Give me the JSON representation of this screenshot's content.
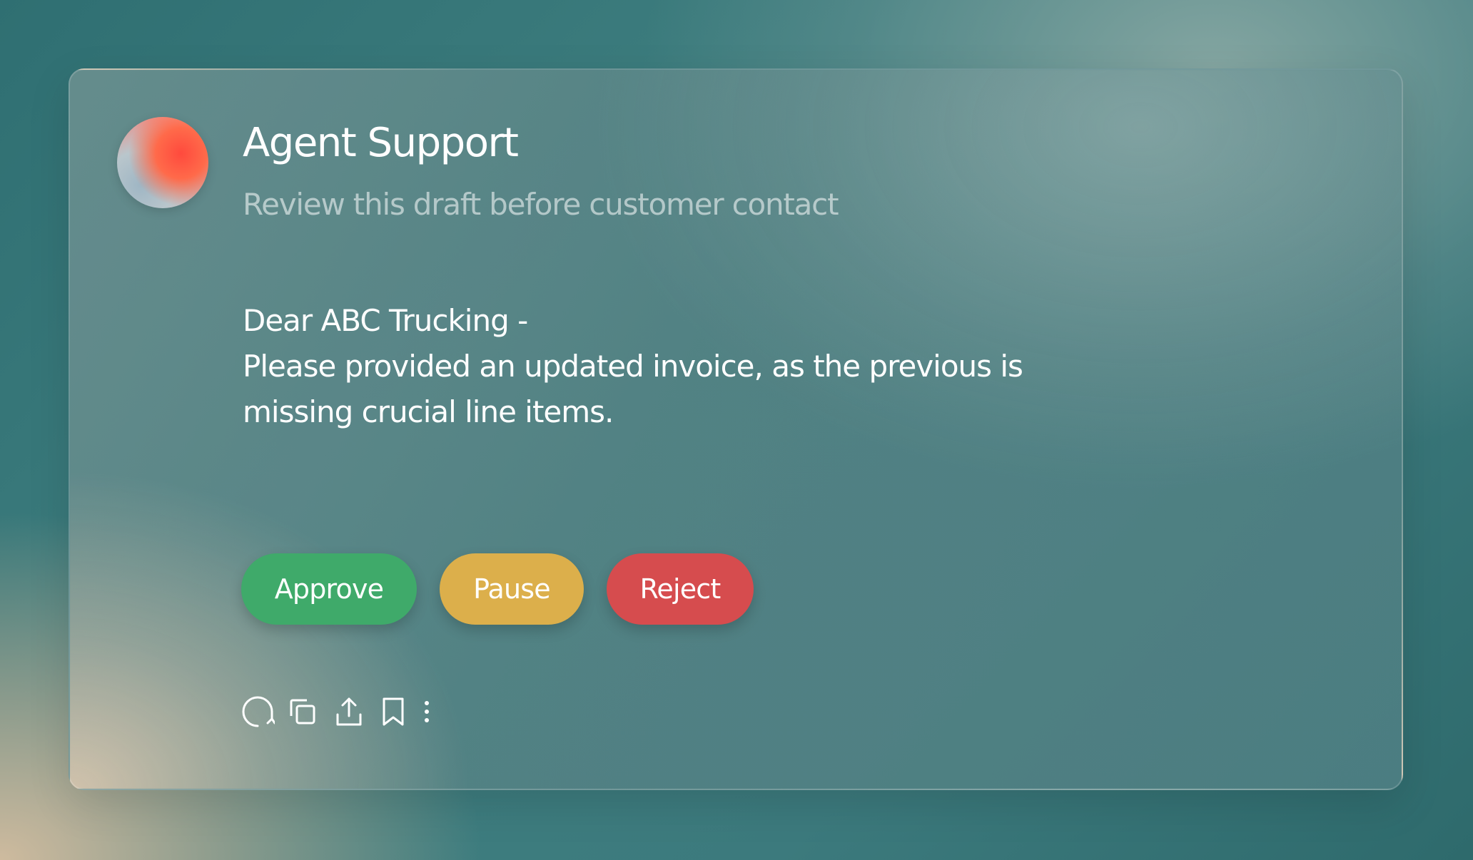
{
  "card": {
    "title": "Agent Support",
    "subtitle": "Review this draft before customer contact",
    "message_lines": [
      "Dear ABC Trucking -",
      "Please provided an updated invoice, as the previous is",
      "missing crucial line items."
    ]
  },
  "actions": {
    "approve_label": "Approve",
    "pause_label": "Pause",
    "reject_label": "Reject"
  },
  "toolbar": {
    "icons": [
      "refresh-icon",
      "copy-icon",
      "share-icon",
      "bookmark-icon",
      "more-icon"
    ]
  },
  "colors": {
    "approve": "#3faa6a",
    "pause": "#dcaf4b",
    "reject": "#d64c4e"
  }
}
